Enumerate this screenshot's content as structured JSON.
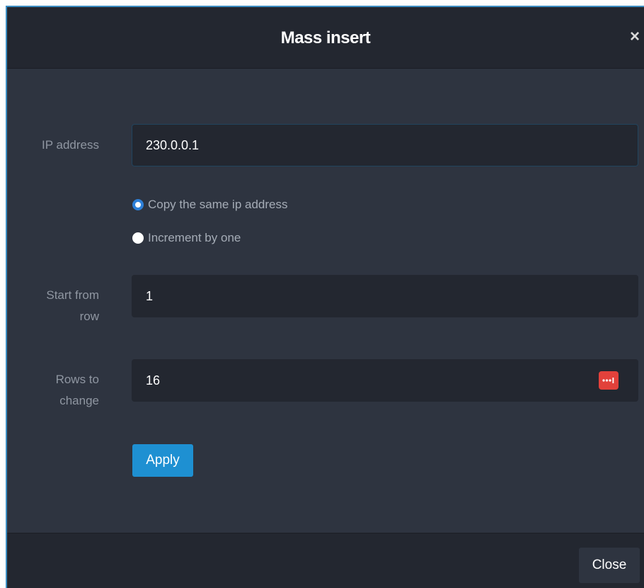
{
  "dialog": {
    "title": "Mass insert",
    "close_glyph": "×"
  },
  "form": {
    "ip_address": {
      "label": "IP address",
      "value": "230.0.0.1"
    },
    "mode_options": [
      {
        "label": "Copy the same ip address",
        "selected": true
      },
      {
        "label": "Increment by one",
        "selected": false
      }
    ],
    "start_from_row": {
      "label_line1": "Start from",
      "label_line2": "row",
      "value": "1"
    },
    "rows_to_change": {
      "label_line1": "Rows to",
      "label_line2": "change",
      "value": "16",
      "stepper_icon": "ellipsis-stepper-icon"
    },
    "apply_label": "Apply"
  },
  "footer": {
    "close_label": "Close"
  },
  "colors": {
    "accent": "#1e90d2",
    "radio_checked": "#2d80d9",
    "stepper_icon": "#e2413b"
  }
}
